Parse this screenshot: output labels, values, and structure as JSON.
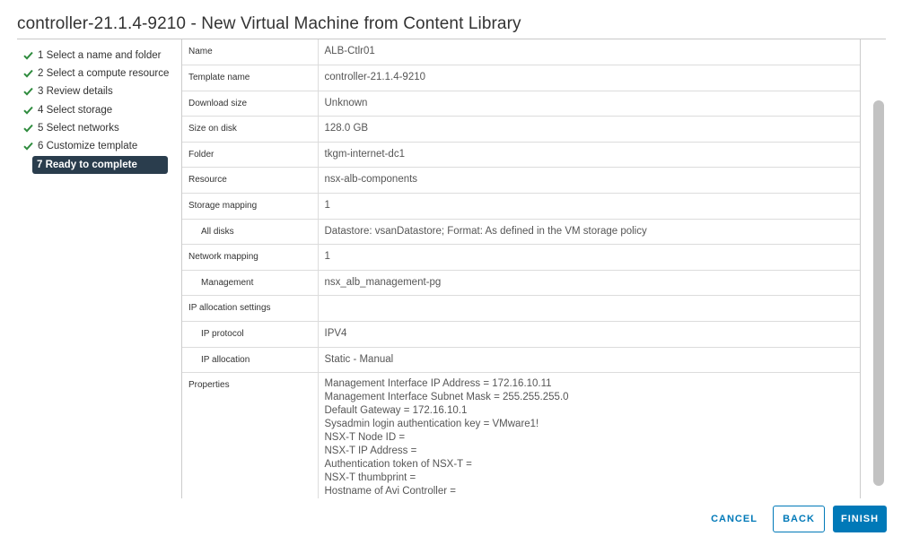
{
  "dialog": {
    "title": "controller-21.1.4-9210 - New Virtual Machine from Content Library"
  },
  "steps": [
    {
      "label": "1 Select a name and folder",
      "done": true
    },
    {
      "label": "2 Select a compute resource",
      "done": true
    },
    {
      "label": "3 Review details",
      "done": true
    },
    {
      "label": "4 Select storage",
      "done": true
    },
    {
      "label": "5 Select networks",
      "done": true
    },
    {
      "label": "6 Customize template",
      "done": true
    },
    {
      "label": "7 Ready to complete",
      "done": false,
      "active": true
    }
  ],
  "review": {
    "rows": [
      {
        "key": "Name",
        "value": "ALB-Ctlr01"
      },
      {
        "key": "Template name",
        "value": "controller-21.1.4-9210"
      },
      {
        "key": "Download size",
        "value": "Unknown"
      },
      {
        "key": "Size on disk",
        "value": "128.0 GB"
      },
      {
        "key": "Folder",
        "value": "tkgm-internet-dc1"
      },
      {
        "key": "Resource",
        "value": "nsx-alb-components"
      },
      {
        "key": "Storage mapping",
        "value": "1"
      },
      {
        "key": "All disks",
        "value": "Datastore: vsanDatastore; Format: As defined in the VM storage policy"
      },
      {
        "key": "Network mapping",
        "value": "1"
      },
      {
        "key": "Management",
        "value": "nsx_alb_management-pg"
      },
      {
        "key": "IP allocation settings",
        "value": ""
      },
      {
        "key": "IP protocol",
        "value": "IPV4"
      },
      {
        "key": "IP allocation",
        "value": "Static - Manual"
      }
    ],
    "properties_label": "Properties",
    "properties": [
      "Management Interface IP Address = 172.16.10.11",
      "Management Interface Subnet Mask = 255.255.255.0",
      "Default Gateway = 172.16.10.1",
      "Sysadmin login authentication key = VMware1!",
      "NSX-T Node ID =",
      "NSX-T IP Address =",
      "Authentication token of NSX-T =",
      "NSX-T thumbprint =",
      "Hostname of Avi Controller ="
    ]
  },
  "footer": {
    "cancel_label": "CANCEL",
    "back_label": "BACK",
    "finish_label": "FINISH"
  },
  "colors": {
    "accent": "#0079b8",
    "check": "#2e8b3d",
    "active_step_bg": "#2a3d4d"
  },
  "icons": {
    "step_done": "check-icon"
  }
}
